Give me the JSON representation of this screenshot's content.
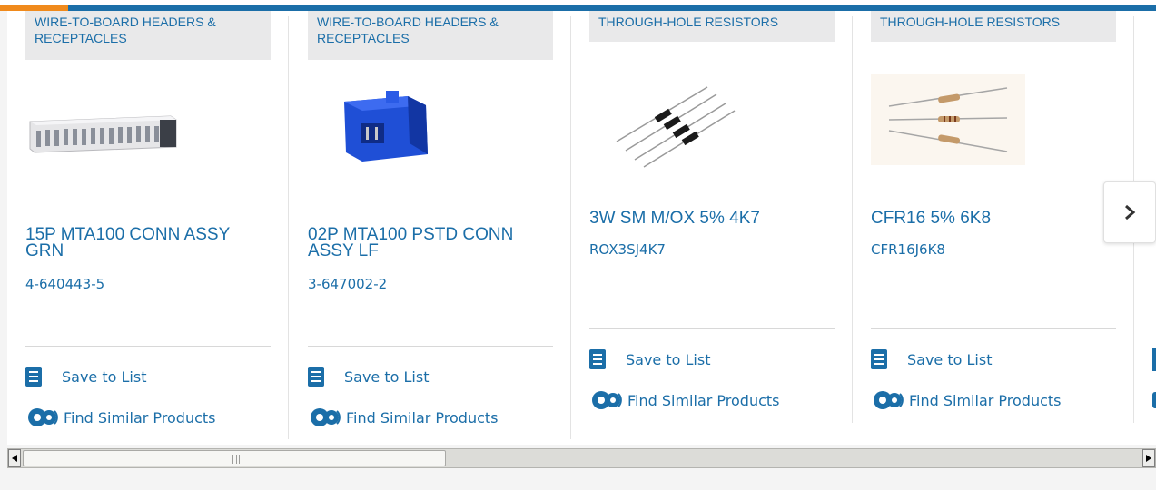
{
  "colors": {
    "accent_blue": "#1b6ea8",
    "accent_orange": "#f08a1c",
    "category_bg": "#e9e9ea"
  },
  "cards": [
    {
      "category": "WIRE-TO-BOARD HEADERS & RECEPTACLES",
      "title": "15P MTA100 CONN ASSY GRN",
      "part_number": "4-640443-5",
      "image": "white-multipin-connector",
      "save_label": "Save to List",
      "similar_label": "Find Similar Products"
    },
    {
      "category": "WIRE-TO-BOARD HEADERS & RECEPTACLES",
      "title": "02P MTA100 PSTD CONN ASSY LF",
      "part_number": "3-647002-2",
      "image": "blue-2pin-connector",
      "save_label": "Save to List",
      "similar_label": "Find Similar Products"
    },
    {
      "category": "THROUGH-HOLE RESISTORS",
      "title": "3W SM M/OX 5% 4K7",
      "part_number": "ROX3SJ4K7",
      "image": "black-resistors",
      "save_label": "Save to List",
      "similar_label": "Find Similar Products"
    },
    {
      "category": "THROUGH-HOLE RESISTORS",
      "title": "CFR16 5% 6K8",
      "part_number": "CFR16J6K8",
      "image": "tan-resistors",
      "save_label": "Save to List",
      "similar_label": "Find Similar Products"
    }
  ],
  "icons": {
    "next": "chevron-right-icon",
    "save": "checklist-icon",
    "similar": "gears-icon"
  }
}
